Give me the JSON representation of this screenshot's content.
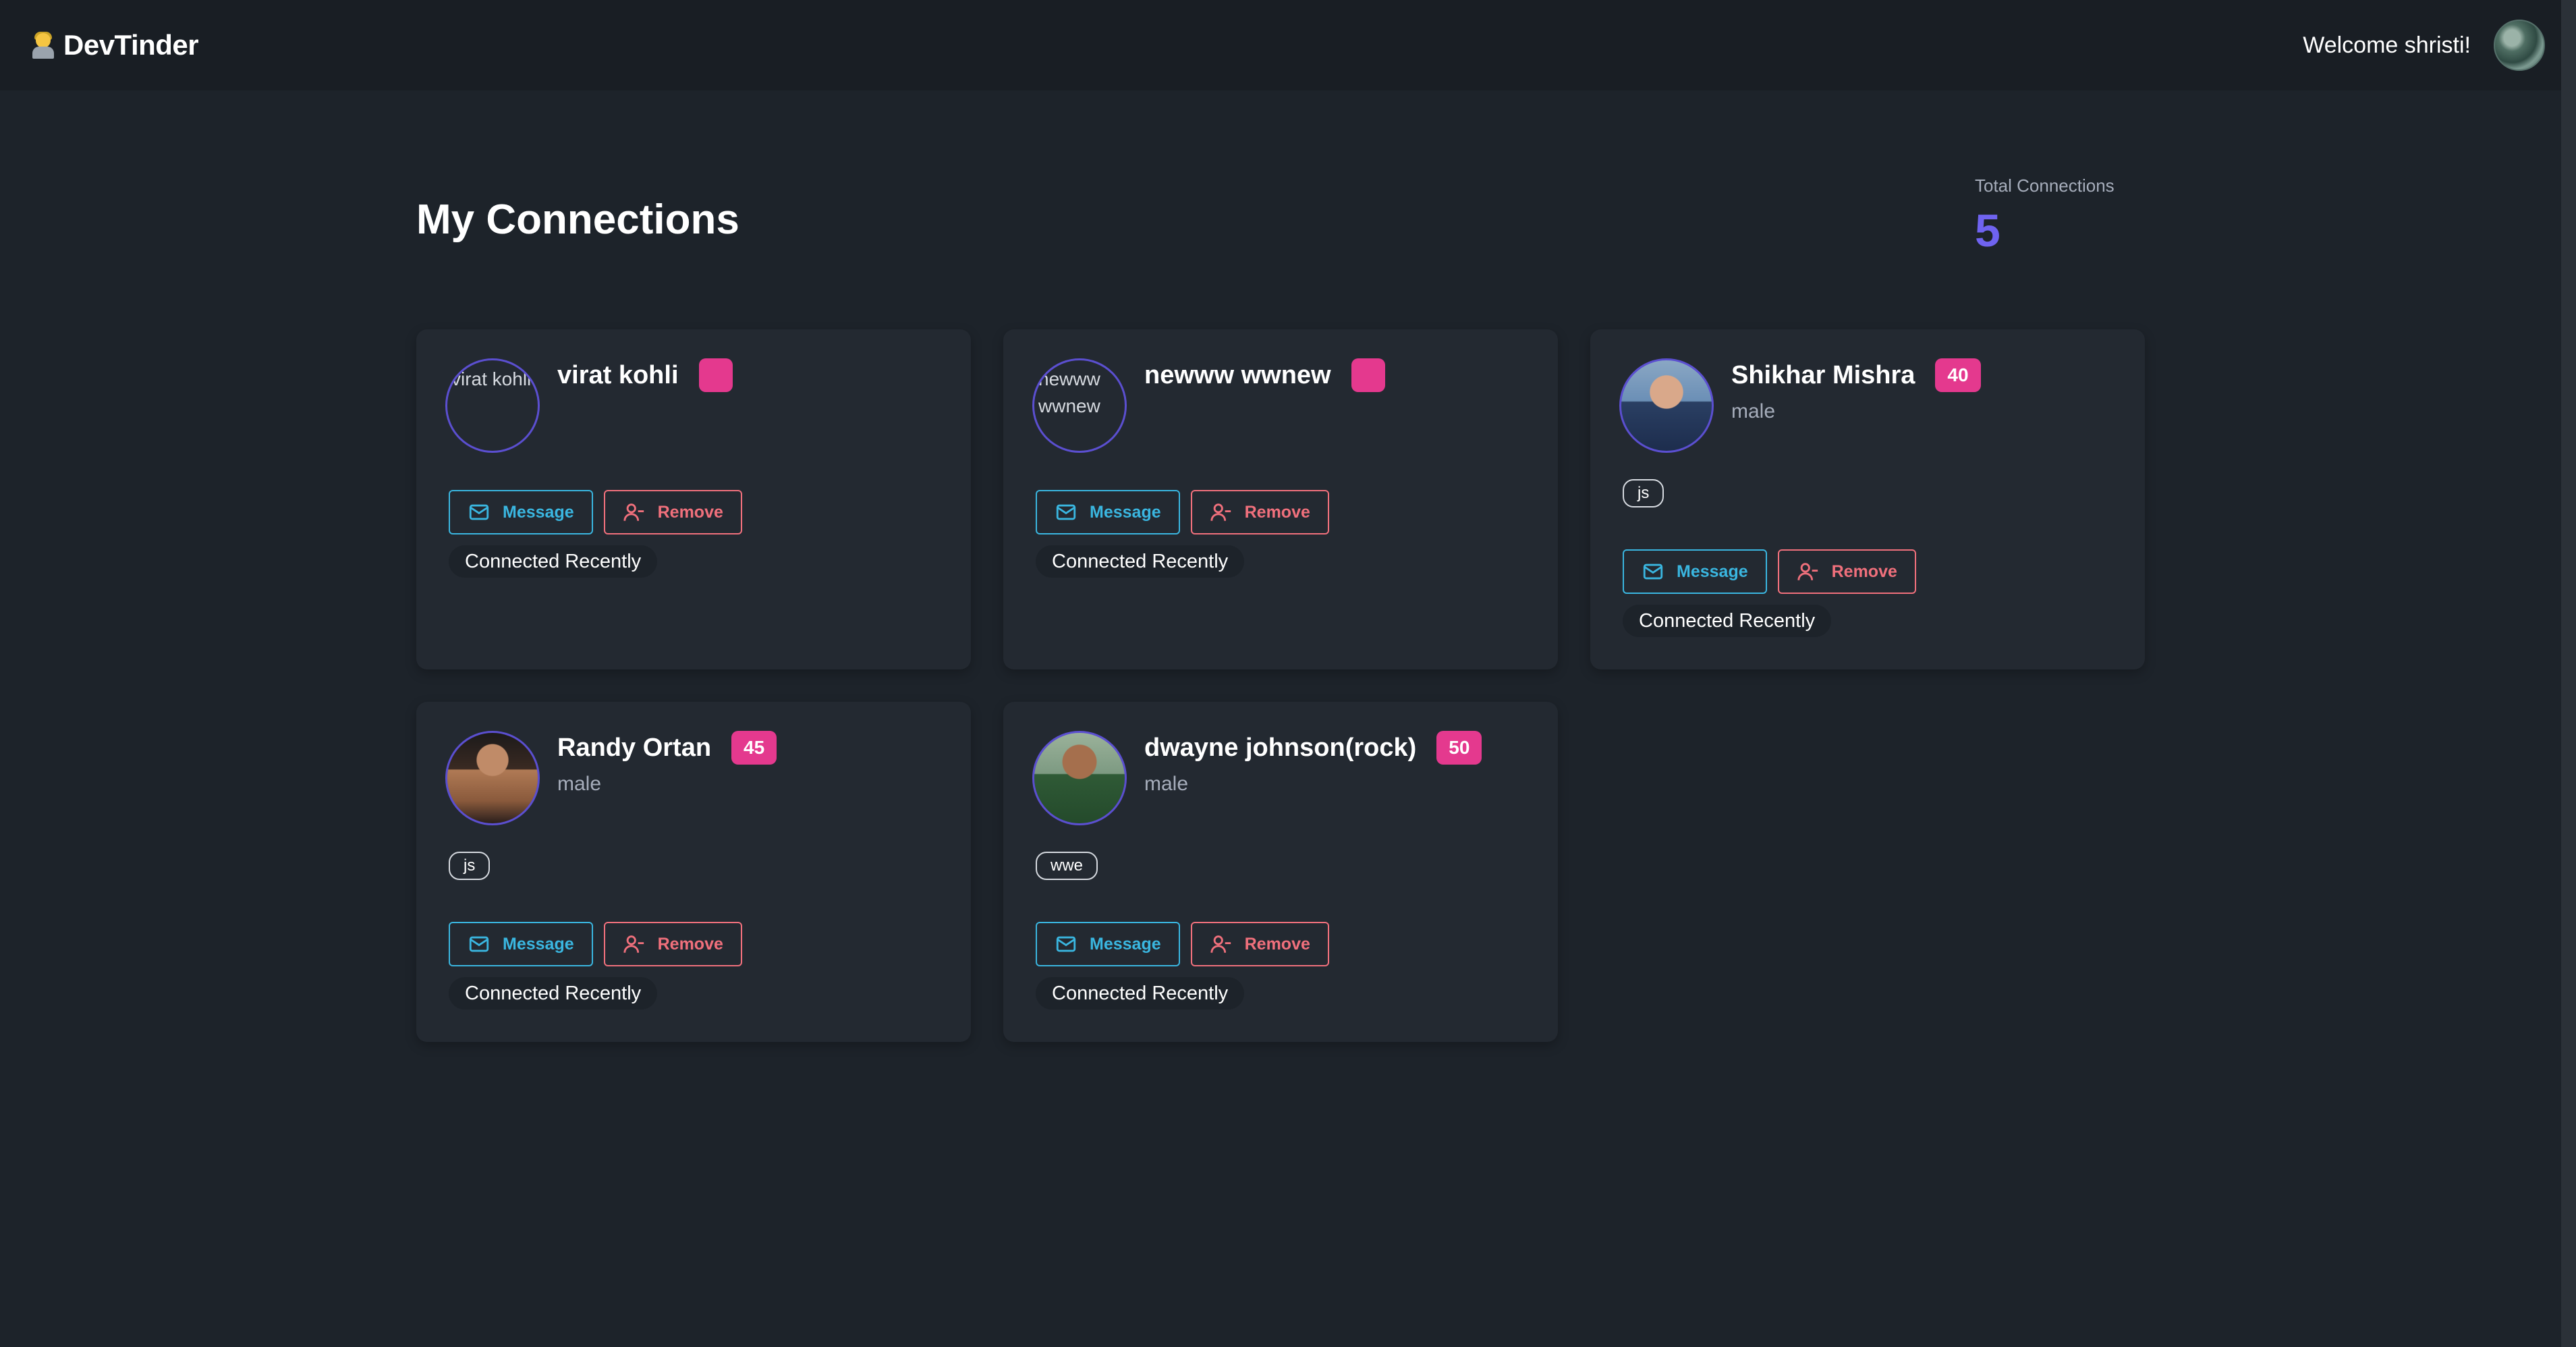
{
  "nav": {
    "brand": "DevTinder",
    "welcome": "Welcome shristi!"
  },
  "page": {
    "title": "My Connections"
  },
  "stats": {
    "label": "Total Connections",
    "value": "5"
  },
  "cards": [
    {
      "name": "virat kohli",
      "age": "",
      "gender": "",
      "skills": [],
      "avatar_alt": "virat kohli",
      "message": "Message",
      "remove": "Remove",
      "status": "Connected Recently"
    },
    {
      "name": "newww wwnew",
      "age": "",
      "gender": "",
      "skills": [],
      "avatar_alt": "newww wwnew",
      "message": "Message",
      "remove": "Remove",
      "status": "Connected Recently"
    },
    {
      "name": "Shikhar Mishra",
      "age": "40",
      "gender": "male",
      "skills": [
        "js"
      ],
      "message": "Message",
      "remove": "Remove",
      "status": "Connected Recently"
    },
    {
      "name": "Randy Ortan",
      "age": "45",
      "gender": "male",
      "skills": [
        "js"
      ],
      "message": "Message",
      "remove": "Remove",
      "status": "Connected Recently"
    },
    {
      "name": "dwayne johnson(rock)",
      "age": "50",
      "gender": "male",
      "skills": [
        "wwe"
      ],
      "message": "Message",
      "remove": "Remove",
      "status": "Connected Recently"
    }
  ],
  "colors": {
    "accent": "#6f63f0",
    "badge": "#e4398e",
    "message": "#3ab6e0",
    "remove": "#f0707c"
  }
}
